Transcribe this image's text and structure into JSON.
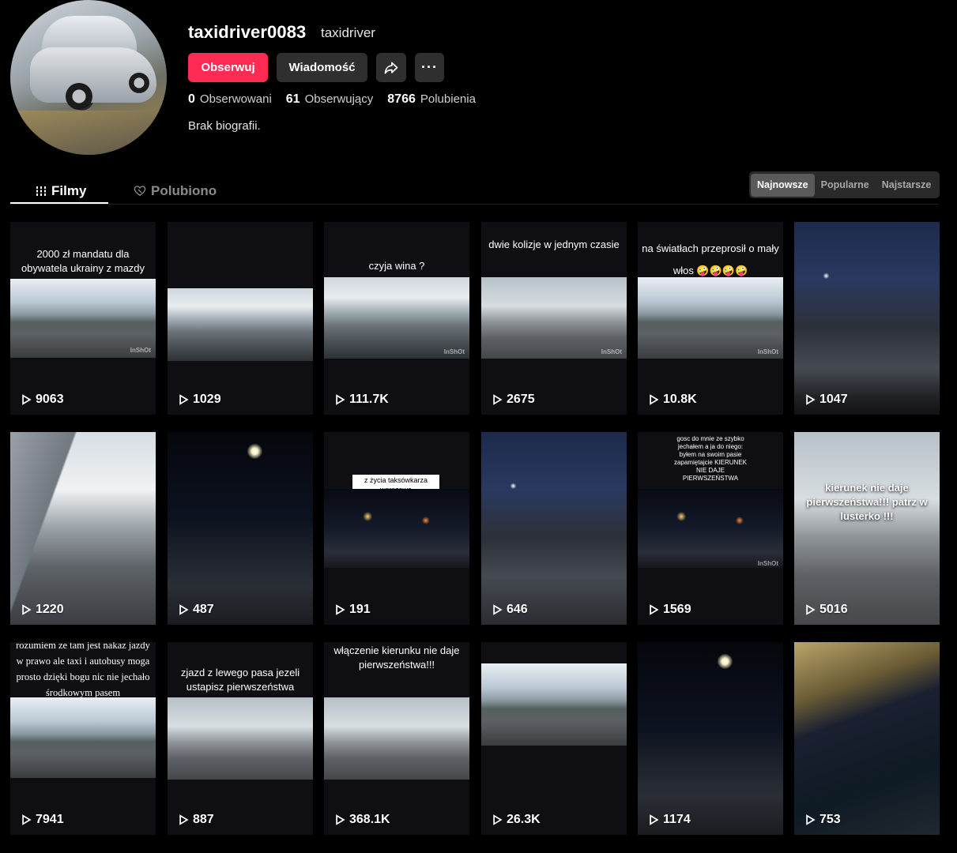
{
  "profile": {
    "username": "taxidriver0083",
    "nickname": "taxidriver",
    "follow_label": "Obserwuj",
    "message_label": "Wiadomość",
    "share_icon": "share-icon",
    "more_icon": "more-icon",
    "more_label": "···",
    "stats": {
      "following_count": "0",
      "following_label": "Obserwowani",
      "followers_count": "61",
      "followers_label": "Obserwujący",
      "likes_count": "8766",
      "likes_label": "Polubienia"
    },
    "bio": "Brak biografii."
  },
  "tabs": [
    {
      "label": "Filmy",
      "icon": "grid-icon",
      "active": true
    },
    {
      "label": "Polubiono",
      "icon": "heart-outline-icon",
      "active": false
    }
  ],
  "sort_options": [
    {
      "label": "Najnowsze",
      "active": true
    },
    {
      "label": "Popularne",
      "active": false
    },
    {
      "label": "Najstarsze",
      "active": false
    }
  ],
  "videos": [
    {
      "views": "9063",
      "caption": "2000 zł mandatu dla obywatela ukrainy z mazdy",
      "stamp": "InShOt"
    },
    {
      "views": "1029",
      "caption": ""
    },
    {
      "views": "111.7K",
      "caption": "czyja wina ?",
      "stamp": "InShOt"
    },
    {
      "views": "2675",
      "caption": "dwie kolizje w jednym czasie",
      "stamp": "InShOt"
    },
    {
      "views": "10.8K",
      "caption": "na światłach przeprosił o mały włos 🤪🤪🤪🤪",
      "stamp": "InShOt"
    },
    {
      "views": "1047",
      "caption": ""
    },
    {
      "views": "1220",
      "caption": ""
    },
    {
      "views": "487",
      "caption": ""
    },
    {
      "views": "191",
      "caption": "z życia taksówkarza warszawa"
    },
    {
      "views": "646",
      "caption": ""
    },
    {
      "views": "1569",
      "caption": "gosc do mnie ze szybko jechałem a ja do niego: byłem na swoim pasie zapamiętajcie KIERUNEK NIE DAJE PIERWSZEŃSTWA",
      "stamp": "InShOt"
    },
    {
      "views": "5016",
      "caption": "kierunek nie daje pierwszeństwa!!! patrz w lusterko !!!"
    },
    {
      "views": "7941",
      "caption": "rozumiem ze tam jest nakaz jazdy w prawo ale taxi i autobusy moga prosto dzięki bogu nic nie jechało środkowym pasem"
    },
    {
      "views": "887",
      "caption": "zjazd z lewego pasa jezeli ustapisz pierwszeństwa"
    },
    {
      "views": "368.1K",
      "caption": "włączenie kierunku nie daje pierwszeństwa!!!"
    },
    {
      "views": "26.3K",
      "caption": ""
    },
    {
      "views": "1174",
      "caption": ""
    },
    {
      "views": "753",
      "caption": ""
    }
  ]
}
